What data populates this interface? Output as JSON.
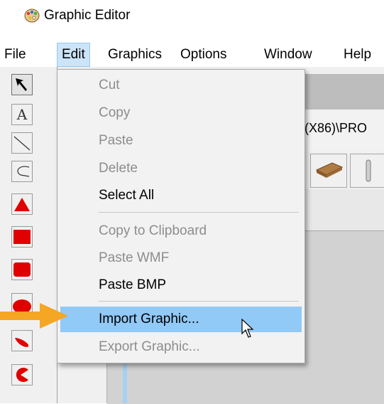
{
  "window": {
    "title": "Graphic Editor",
    "icon": "graphic-editor-app-icon"
  },
  "menubar": {
    "items": [
      {
        "label": "File",
        "active": false
      },
      {
        "label": "Edit",
        "active": true
      },
      {
        "label": "Graphics",
        "active": false
      },
      {
        "label": "Options",
        "active": false
      },
      {
        "label": "Window",
        "active": false
      },
      {
        "label": "Help",
        "active": false
      }
    ]
  },
  "toolbox": {
    "tools": [
      {
        "name": "select-arrow-icon"
      },
      {
        "name": "text-tool-icon",
        "glyph": "A"
      },
      {
        "name": "line-tool-icon"
      },
      {
        "name": "arc-tool-icon"
      },
      {
        "name": "triangle-tool-icon"
      },
      {
        "name": "rectangle-tool-icon"
      },
      {
        "name": "rounded-rectangle-tool-icon"
      },
      {
        "name": "ellipse-tool-icon"
      },
      {
        "name": "chord-tool-icon"
      },
      {
        "name": "pie-tool-icon"
      }
    ],
    "shape_color": "#e00000"
  },
  "document": {
    "path_fragment": "(X86)\\PRO"
  },
  "edit_menu": {
    "items": [
      {
        "label": "Cut",
        "enabled": false
      },
      {
        "label": "Copy",
        "enabled": false
      },
      {
        "label": "Paste",
        "enabled": false
      },
      {
        "label": "Delete",
        "enabled": false
      },
      {
        "label": "Select All",
        "enabled": true
      },
      {
        "label": "Copy to Clipboard",
        "enabled": false
      },
      {
        "label": "Paste WMF",
        "enabled": false
      },
      {
        "label": "Paste BMP",
        "enabled": true
      },
      {
        "label": "Import Graphic...",
        "enabled": true,
        "highlighted": true
      },
      {
        "label": "Export Graphic...",
        "enabled": false
      }
    ]
  },
  "colors": {
    "highlight": "#91c9f7",
    "menu_active": "#cce4f7",
    "arrow": "#f5a623",
    "disabled_text": "#8d8d8d"
  }
}
